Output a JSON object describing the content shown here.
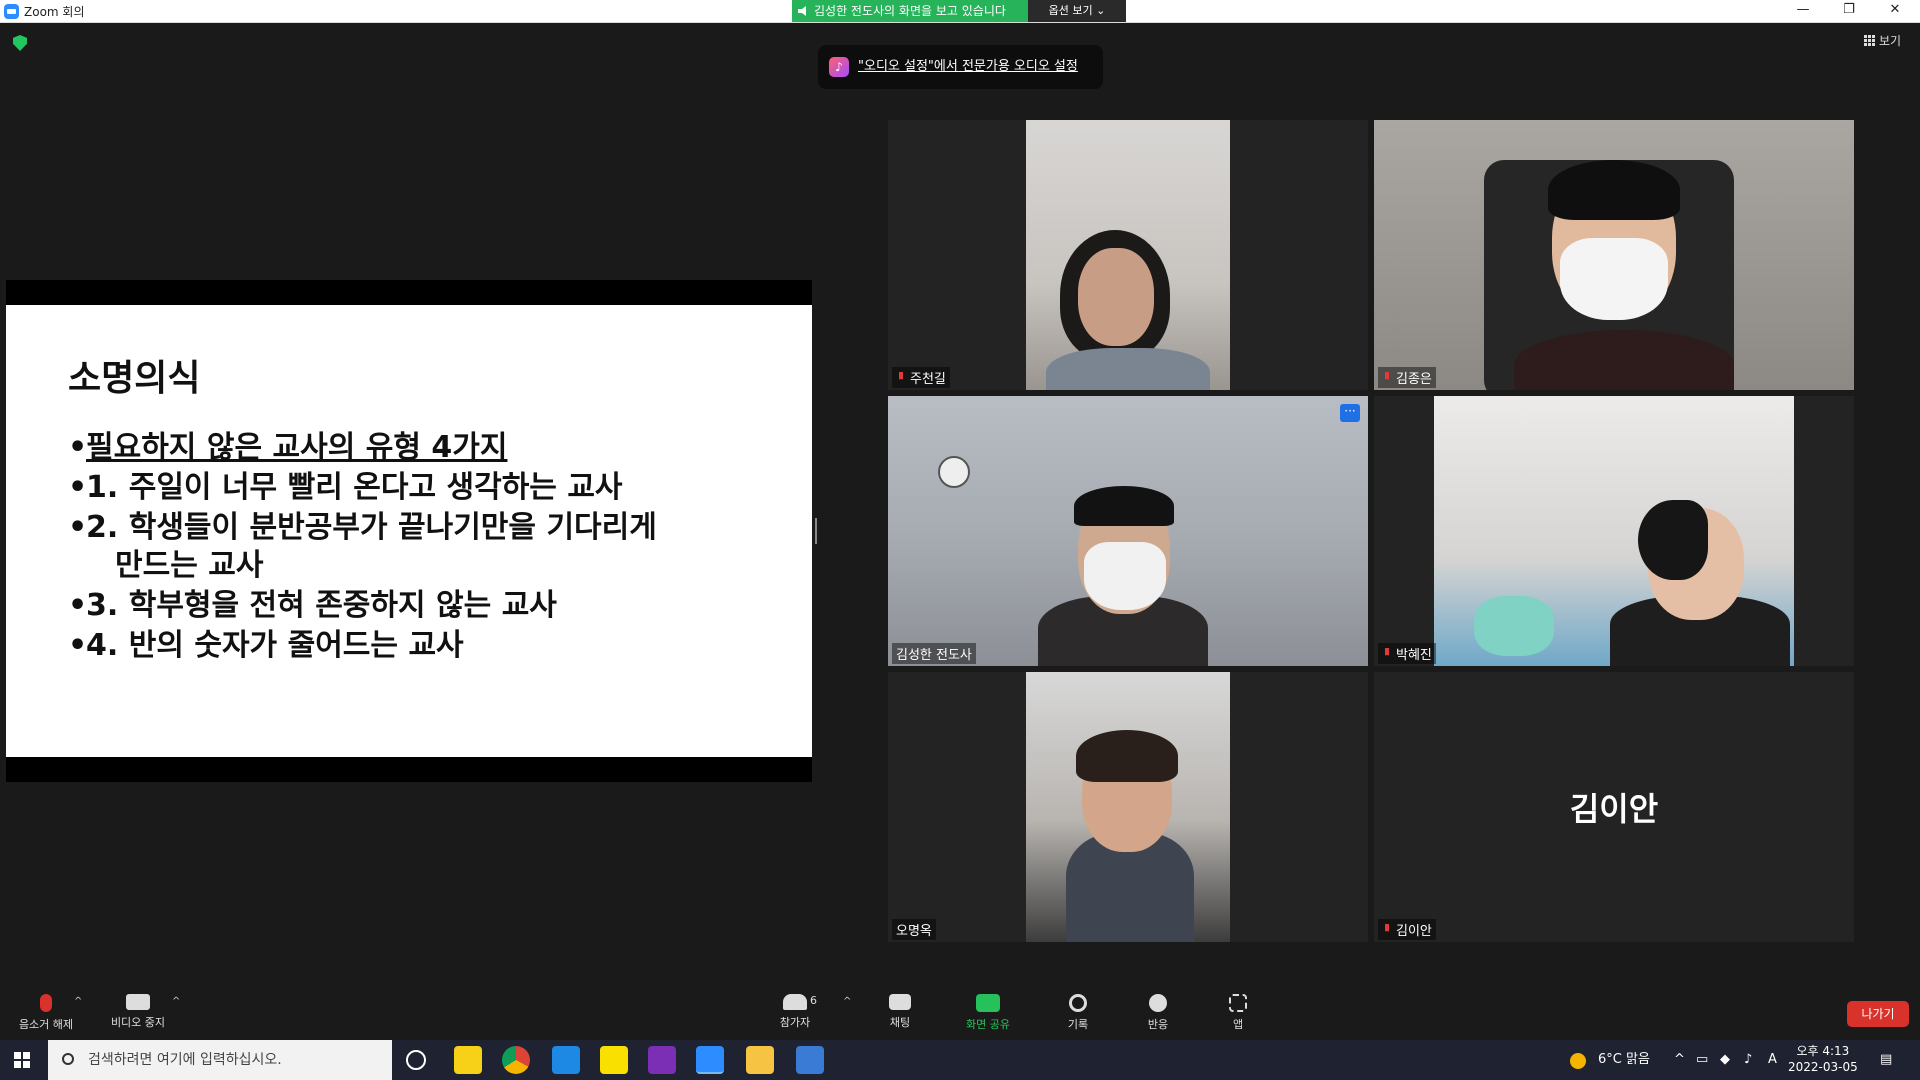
{
  "window": {
    "title": "Zoom 회의"
  },
  "share_banner": {
    "text": "김성한 전도사의 화면을 보고 있습니다",
    "view_options": "옵션 보기 ⌄"
  },
  "window_controls": {
    "minimize": "—",
    "restore": "❐",
    "close": "✕"
  },
  "view_button": "보기",
  "audio_tip": {
    "text": "\"오디오 설정\"에서 전문가용 오디오 설정"
  },
  "slide": {
    "title": "소명의식",
    "bullets": [
      "필요하지 않은 교사의 유형 4가지",
      "1. 주일이 너무 빨리 온다고 생각하는 교사",
      "2. 학생들이 분반공부가 끝나기만을 기다리게",
      "만드는 교사",
      "3. 학부형을 전혀 존중하지 않는 교사",
      "4. 반의 숫자가 줄어드는 교사"
    ]
  },
  "participants": [
    {
      "name": "주천길",
      "muted": true
    },
    {
      "name": "김종은",
      "muted": true
    },
    {
      "name": "김성한 전도사",
      "muted": false,
      "active_speaker": true
    },
    {
      "name": "박혜진",
      "muted": true
    },
    {
      "name": "오명옥",
      "muted": false
    },
    {
      "name": "김이안",
      "muted": true,
      "video_off": true,
      "avatar_text": "김이안"
    }
  ],
  "more_button": "···",
  "controls": {
    "unmute": "음소거 해제",
    "stop_video": "비디오 중지",
    "participants": "참가자",
    "participants_count": "6",
    "chat": "채팅",
    "share_screen": "화면 공유",
    "record": "기록",
    "reactions": "반응",
    "apps": "앱",
    "leave": "나가기",
    "caret": "^"
  },
  "taskbar": {
    "search_placeholder": "검색하려면 여기에 입력하십시오.",
    "weather": "6°C 맑음",
    "time": "오후 4:13",
    "date": "2022-03-05",
    "ime": "A"
  },
  "colors": {
    "share_green": "#26b35a",
    "active_border": "#d7f252",
    "leave_red": "#d9322b",
    "zoom_blue": "#2d8cff"
  }
}
